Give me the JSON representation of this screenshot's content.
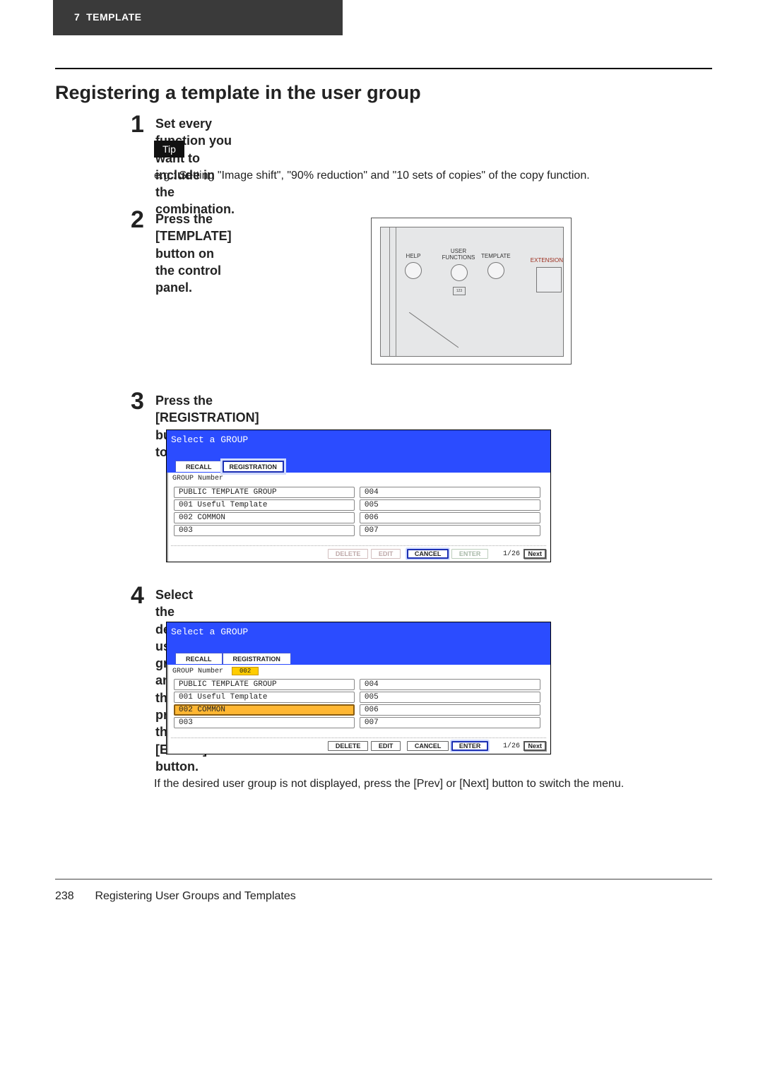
{
  "header": {
    "chapter": "7",
    "chapter_label": "TEMPLATE"
  },
  "section_title": "Registering a template in the user group",
  "steps": {
    "s1": {
      "num": "1",
      "heading": "Set every function you want to include in the combination.",
      "tip_label": "Tip",
      "tip_text": "e.g.: Setting \"Image shift\", \"90% reduction\" and \"10 sets of copies\" of the copy function."
    },
    "s2": {
      "num": "2",
      "heading": "Press the [TEMPLATE] button on the control panel.",
      "panel": {
        "help": "HELP",
        "user_functions": "USER FUNCTIONS",
        "template": "TEMPLATE",
        "extension": "EXTENSION",
        "indicator": "123"
      }
    },
    "s3": {
      "num": "3",
      "heading": "Press the [REGISTRATION] button on the touch panel.",
      "screen": {
        "title": "Select a GROUP",
        "tab_recall": "RECALL",
        "tab_registration": "REGISTRATION",
        "subhead": "GROUP Number",
        "left": [
          "PUBLIC TEMPLATE GROUP",
          "001 Useful Template",
          "002 COMMON",
          "003"
        ],
        "right": [
          "004",
          "005",
          "006",
          "007"
        ],
        "btn_delete": "DELETE",
        "btn_edit": "EDIT",
        "btn_cancel": "CANCEL",
        "btn_enter": "ENTER",
        "pager": "1/26",
        "btn_next": "Next"
      }
    },
    "s4": {
      "num": "4",
      "heading": "Select the desired user group, and then press the [ENTER] button.",
      "group_number_value": "002",
      "screen": {
        "title": "Select a GROUP",
        "tab_recall": "RECALL",
        "tab_registration": "REGISTRATION",
        "subhead": "GROUP Number",
        "left": [
          "PUBLIC TEMPLATE GROUP",
          "001 Useful Template",
          "002 COMMON",
          "003"
        ],
        "right": [
          "004",
          "005",
          "006",
          "007"
        ],
        "btn_delete": "DELETE",
        "btn_edit": "EDIT",
        "btn_cancel": "CANCEL",
        "btn_enter": "ENTER",
        "pager": "1/26",
        "btn_next": "Next"
      },
      "note": "If the desired user group is not displayed, press the [Prev] or [Next] button to switch the menu."
    }
  },
  "footer": {
    "page_number": "238",
    "title": "Registering User Groups and Templates"
  }
}
